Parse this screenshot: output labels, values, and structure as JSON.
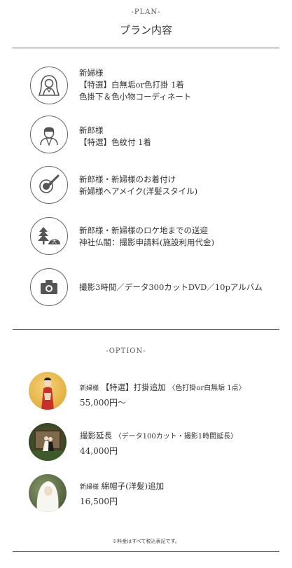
{
  "plan": {
    "kicker": "-PLAN-",
    "title": "プラン内容",
    "items": [
      {
        "icon": "bride-icon",
        "lines": [
          "新婦様",
          "【特選】白無垢or色打掛 1着",
          "色掛下＆色小物コーディネート"
        ]
      },
      {
        "icon": "groom-icon",
        "lines": [
          "新郎様",
          "【特選】色紋付 1着"
        ]
      },
      {
        "icon": "makeup-icon",
        "lines": [
          "新郎様・新婦様のお着付け",
          "新婦様ヘアメイク(洋髪スタイル)"
        ]
      },
      {
        "icon": "location-icon",
        "lines": [
          "新郎様・新婦様のロケ地までの送迎",
          "神社仏閣：撮影申請料(施設利用代金)"
        ]
      },
      {
        "icon": "camera-icon",
        "lines": [
          "撮影3時間／データ300カットDVD／10pアルバム"
        ]
      }
    ]
  },
  "option": {
    "kicker": "-OPTION-",
    "items": [
      {
        "prefix": "新婦様",
        "name": "【特選】打掛追加",
        "detail": "〈色打掛or白無垢 1点〉",
        "price": "55,000円〜"
      },
      {
        "prefix": "",
        "name": "撮影延長",
        "detail": "〈データ100カット・撮影1時間延長〉",
        "price": "44,000円"
      },
      {
        "prefix": "新婦様",
        "name": "綿帽子(洋髪)追加",
        "detail": "",
        "price": "16,500円"
      }
    ]
  },
  "note": "※料金はすべて税込表記です。"
}
